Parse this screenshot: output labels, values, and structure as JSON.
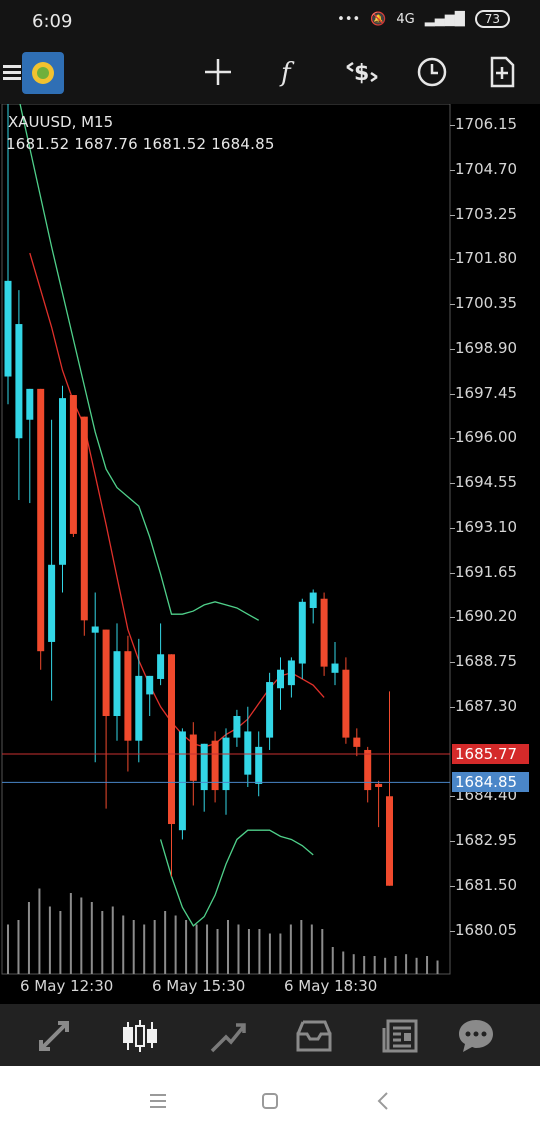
{
  "status_bar": {
    "time": "6:09",
    "network": "4G",
    "battery": "73"
  },
  "toolbar": {
    "items": [
      "menu-icon",
      "app-logo",
      "crosshair-icon",
      "indicators-icon",
      "trade-icon",
      "timeframe-icon",
      "add-object-icon"
    ]
  },
  "chart_header": {
    "symbol": "XAUUSD, M15",
    "ohlc": "1681.52 1687.76 1681.52 1684.85"
  },
  "chart_data": {
    "type": "candlestick",
    "symbol": "XAUUSD, M15",
    "price_ticks": [
      "1706.15",
      "1704.70",
      "1703.25",
      "1701.80",
      "1700.35",
      "1698.90",
      "1697.45",
      "1696.00",
      "1694.55",
      "1693.10",
      "1691.65",
      "1690.20",
      "1688.75",
      "1687.30",
      "1684.40",
      "1682.95",
      "1681.50",
      "1680.05"
    ],
    "time_labels": [
      "6 May 12:30",
      "6 May 15:30",
      "6 May 18:30"
    ],
    "bid_price": "1684.85",
    "ask_price": "1685.77",
    "colors": {
      "bull": "#33d6e6",
      "bear": "#f04a2d",
      "bands": "#4fd08a",
      "ma": "#e0302a",
      "bid_line": "#4a86c8",
      "ask_line": "#c93030"
    },
    "candles": [
      {
        "o": 1698.0,
        "h": 1707.2,
        "l": 1697.1,
        "c": 1701.1
      },
      {
        "o": 1696.0,
        "h": 1700.8,
        "l": 1694.0,
        "c": 1699.7
      },
      {
        "o": 1696.6,
        "h": 1697.6,
        "l": 1693.9,
        "c": 1697.6
      },
      {
        "o": 1697.6,
        "h": 1697.6,
        "l": 1688.5,
        "c": 1689.1
      },
      {
        "o": 1689.4,
        "h": 1696.6,
        "l": 1687.5,
        "c": 1691.9
      },
      {
        "o": 1691.9,
        "h": 1697.7,
        "l": 1691.0,
        "c": 1697.3
      },
      {
        "o": 1697.4,
        "h": 1697.4,
        "l": 1692.8,
        "c": 1692.9
      },
      {
        "o": 1696.7,
        "h": 1696.7,
        "l": 1689.6,
        "c": 1690.1
      },
      {
        "o": 1689.7,
        "h": 1691.0,
        "l": 1685.5,
        "c": 1689.9
      },
      {
        "o": 1689.8,
        "h": 1689.8,
        "l": 1684.0,
        "c": 1687.0
      },
      {
        "o": 1687.0,
        "h": 1690.0,
        "l": 1686.2,
        "c": 1689.1
      },
      {
        "o": 1689.1,
        "h": 1689.6,
        "l": 1685.2,
        "c": 1686.2
      },
      {
        "o": 1686.2,
        "h": 1689.5,
        "l": 1685.5,
        "c": 1688.3
      },
      {
        "o": 1687.7,
        "h": 1688.3,
        "l": 1687.0,
        "c": 1688.3
      },
      {
        "o": 1688.2,
        "h": 1690.0,
        "l": 1688.0,
        "c": 1689.0
      },
      {
        "o": 1689.0,
        "h": 1689.0,
        "l": 1681.8,
        "c": 1683.5
      },
      {
        "o": 1683.3,
        "h": 1686.6,
        "l": 1683.0,
        "c": 1686.5
      },
      {
        "o": 1686.4,
        "h": 1686.8,
        "l": 1684.1,
        "c": 1684.9
      },
      {
        "o": 1684.6,
        "h": 1686.1,
        "l": 1683.9,
        "c": 1686.1
      },
      {
        "o": 1686.2,
        "h": 1686.5,
        "l": 1684.2,
        "c": 1684.6
      },
      {
        "o": 1684.6,
        "h": 1686.6,
        "l": 1683.8,
        "c": 1686.3
      },
      {
        "o": 1686.3,
        "h": 1687.2,
        "l": 1686.0,
        "c": 1687.0
      },
      {
        "o": 1685.1,
        "h": 1687.3,
        "l": 1684.7,
        "c": 1686.5
      },
      {
        "o": 1684.8,
        "h": 1686.5,
        "l": 1684.4,
        "c": 1686.0
      },
      {
        "o": 1686.3,
        "h": 1688.4,
        "l": 1685.9,
        "c": 1688.1
      },
      {
        "o": 1687.9,
        "h": 1688.9,
        "l": 1687.2,
        "c": 1688.5
      },
      {
        "o": 1688.0,
        "h": 1688.9,
        "l": 1687.6,
        "c": 1688.8
      },
      {
        "o": 1688.7,
        "h": 1690.8,
        "l": 1688.2,
        "c": 1690.7
      },
      {
        "o": 1690.5,
        "h": 1691.1,
        "l": 1690.0,
        "c": 1691.0
      },
      {
        "o": 1690.8,
        "h": 1691.0,
        "l": 1688.3,
        "c": 1688.6
      },
      {
        "o": 1688.4,
        "h": 1689.4,
        "l": 1688.0,
        "c": 1688.7
      },
      {
        "o": 1688.5,
        "h": 1688.9,
        "l": 1686.1,
        "c": 1686.3
      },
      {
        "o": 1686.3,
        "h": 1686.6,
        "l": 1685.7,
        "c": 1686.0
      },
      {
        "o": 1685.9,
        "h": 1686.0,
        "l": 1684.2,
        "c": 1684.6
      },
      {
        "o": 1684.8,
        "h": 1684.9,
        "l": 1683.4,
        "c": 1684.7
      },
      {
        "o": 1684.4,
        "h": 1687.8,
        "l": 1681.5,
        "c": 1681.5
      }
    ],
    "band_upper": [
      1708.5,
      1707.0,
      1705.4,
      1703.8,
      1702.2,
      1700.7,
      1699.2,
      1697.7,
      1696.2,
      1695.0,
      1694.4,
      1694.1,
      1693.8,
      1692.8,
      1691.6,
      1690.3,
      1690.3,
      1690.4,
      1690.6,
      1690.7,
      1690.6,
      1690.5,
      1690.3,
      1690.1
    ],
    "band_lower": [
      1683.0,
      1681.8,
      1680.8,
      1680.2,
      1680.5,
      1681.2,
      1682.2,
      1683.0,
      1683.3,
      1683.3,
      1683.3,
      1683.1,
      1683.0,
      1682.8,
      1682.5
    ],
    "ma": [
      1702.0,
      1700.8,
      1699.6,
      1698.2,
      1697.2,
      1696.4,
      1694.8,
      1693.2,
      1691.5,
      1689.8,
      1688.8,
      1688.0,
      1687.3,
      1686.8,
      1686.4,
      1686.1,
      1686.0,
      1686.1,
      1686.4,
      1686.6,
      1686.9,
      1687.4,
      1687.9,
      1688.3,
      1688.4,
      1688.2,
      1688.0,
      1687.6
    ],
    "volumes": [
      0.55,
      0.6,
      0.8,
      0.95,
      0.75,
      0.7,
      0.9,
      0.85,
      0.8,
      0.7,
      0.75,
      0.65,
      0.6,
      0.55,
      0.6,
      0.7,
      0.65,
      0.6,
      0.55,
      0.55,
      0.5,
      0.6,
      0.55,
      0.5,
      0.5,
      0.45,
      0.45,
      0.55,
      0.6,
      0.55,
      0.5,
      0.3,
      0.25,
      0.22,
      0.2,
      0.2,
      0.18,
      0.2,
      0.22,
      0.18,
      0.2,
      0.15
    ]
  },
  "bottom_nav": {
    "items": [
      "quotes-icon",
      "chart-icon",
      "trade-icon",
      "history-icon",
      "news-icon",
      "chat-icon"
    ]
  }
}
